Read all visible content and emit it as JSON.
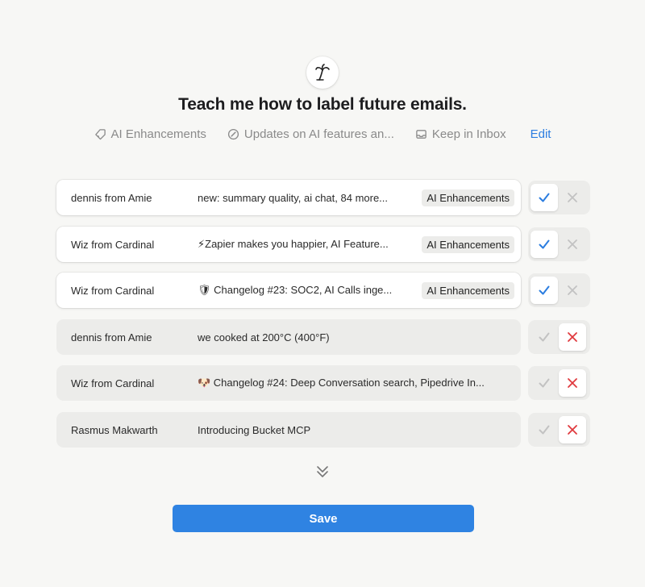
{
  "header": {
    "title": "Teach me how to label future emails."
  },
  "rule": {
    "label": "AI Enhancements",
    "description": "Updates on AI features an...",
    "action": "Keep in Inbox",
    "edit_label": "Edit"
  },
  "emails": [
    {
      "sender": "dennis from Amie",
      "subject": "new: summary quality, ai chat, 84 more...",
      "tag": "AI Enhancements",
      "status": "approved"
    },
    {
      "sender": "Wiz from Cardinal",
      "subject": "⚡Zapier makes you happier, AI Feature...",
      "tag": "AI Enhancements",
      "status": "approved"
    },
    {
      "sender": "Wiz from Cardinal",
      "subject": "🛡 Changelog #23: SOC2, AI Calls inge...",
      "tag": "AI Enhancements",
      "status": "approved"
    },
    {
      "sender": "dennis from Amie",
      "subject": "we cooked at 200°C (400°F)",
      "tag": "",
      "status": "rejected"
    },
    {
      "sender": "Wiz from Cardinal",
      "subject": "🐶 Changelog #24: Deep Conversation search, Pipedrive In...",
      "tag": "",
      "status": "rejected"
    },
    {
      "sender": "Rasmus Makwarth",
      "subject": "Introducing Bucket MCP",
      "tag": "",
      "status": "rejected"
    }
  ],
  "footer": {
    "save_label": "Save"
  },
  "colors": {
    "accent": "#2f83e2",
    "approve": "#2b7de0",
    "reject": "#e0393e"
  },
  "icons": {
    "logo": "palm-tree-icon",
    "label": "tag-icon",
    "description": "edit-icon",
    "action": "inbox-icon",
    "approve": "check-icon",
    "reject": "x-icon",
    "expand": "chevrons-down-icon"
  }
}
